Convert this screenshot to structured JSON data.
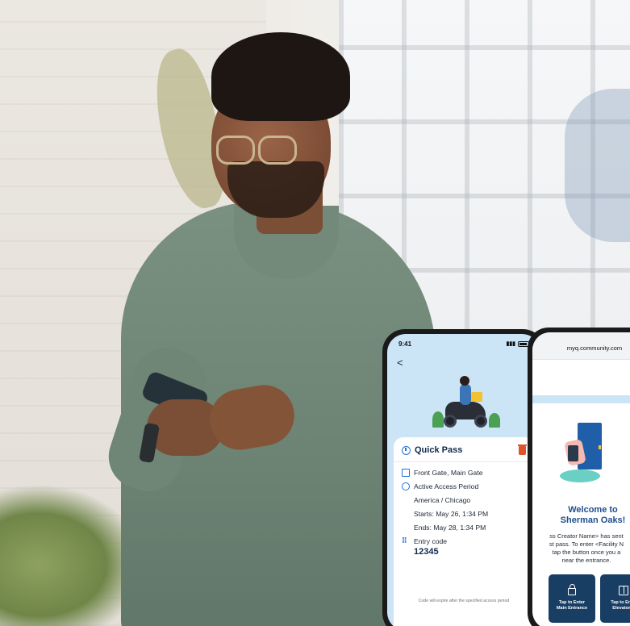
{
  "quick_pass_app": {
    "status_time": "9:41",
    "back_glyph": "<",
    "card_title": "Quick Pass",
    "gate": "Front Gate, Main Gate",
    "period_label": "Active Access Period",
    "timezone": "America / Chicago",
    "starts": "Starts: May 26, 1:34 PM",
    "ends": "Ends: May 28, 1:34 PM",
    "code_label": "Entry code",
    "code_value": "12345",
    "expire_note": "Code will expire after the specified access period",
    "icons": [
      "back-icon",
      "clock-icon",
      "trash-icon",
      "gate-icon",
      "period-icon",
      "keypad-icon"
    ],
    "accent_color": "#1e72d6",
    "delete_color": "#e0532a"
  },
  "web_pass": {
    "url": "myq.community.com",
    "welcome_title_line1": "Welcome to",
    "welcome_title_line2": "Sherman Oaks!",
    "message_line1": "ss Creator Name> has sent",
    "message_line2": "st pass. To enter <Facility N",
    "message_line3": "tap the button once you a",
    "message_line4": "near the entrance.",
    "button_enter": "Tap to Enter\nMain Entrance",
    "button_elevator": "Tap to Enab\nElevator A",
    "icons": [
      "lock-icon",
      "elevator-icon"
    ],
    "button_color": "#183e64"
  }
}
